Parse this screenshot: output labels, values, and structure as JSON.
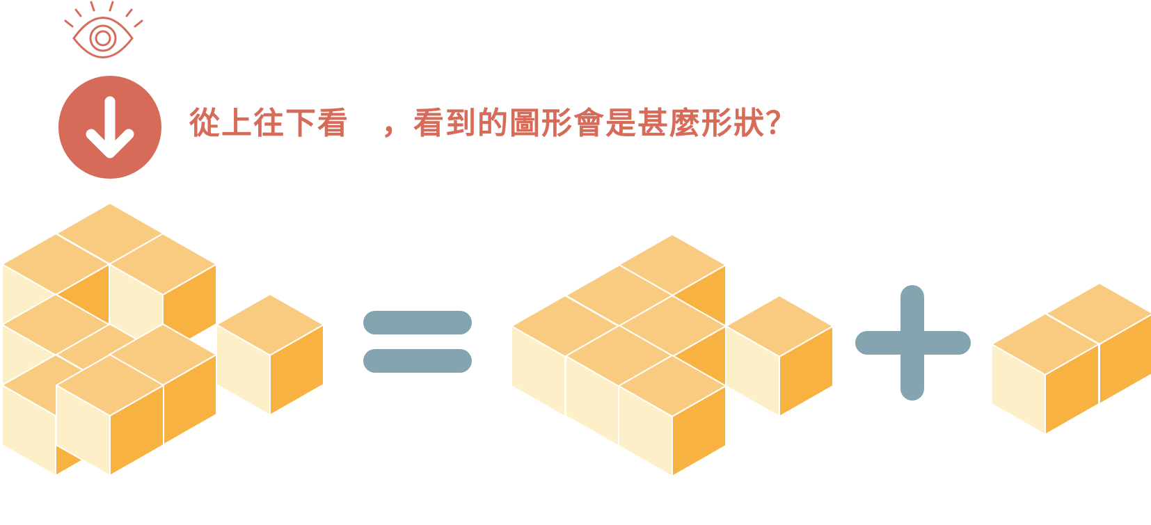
{
  "question": "從上往下看　，看到的圖形會是甚麼形狀？",
  "icons": {
    "eye": "eye-icon",
    "arrow": "arrow-down-circle-icon",
    "equals": "equals-icon",
    "plus": "plus-icon"
  },
  "colors": {
    "accent": "#d66b5a",
    "cube_top": "#f8cb80",
    "cube_left": "#fdf0c8",
    "cube_right": "#f8b242",
    "operator": "#84a4b0"
  },
  "figures": {
    "full_structure": {
      "cubes": 9
    },
    "part_one": {
      "cubes": 7
    },
    "part_two": {
      "cubes": 2
    }
  }
}
